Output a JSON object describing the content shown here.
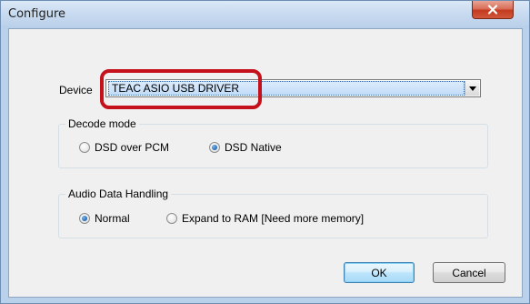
{
  "window": {
    "title": "Configure",
    "titlebar_color": "#c7daf0",
    "close_icon": "close-icon"
  },
  "device": {
    "label": "Device",
    "selected": "TEAC ASIO USB DRIVER",
    "highlight_color": "#c4111b"
  },
  "decode_mode": {
    "title": "Decode mode",
    "options": [
      {
        "label": "DSD over PCM",
        "checked": false
      },
      {
        "label": "DSD Native",
        "checked": true
      }
    ]
  },
  "audio_data_handling": {
    "title": "Audio Data Handling",
    "options": [
      {
        "label": "Normal",
        "checked": true
      },
      {
        "label": "Expand to RAM [Need more memory]",
        "checked": false
      }
    ]
  },
  "buttons": {
    "ok": "OK",
    "cancel": "Cancel"
  }
}
